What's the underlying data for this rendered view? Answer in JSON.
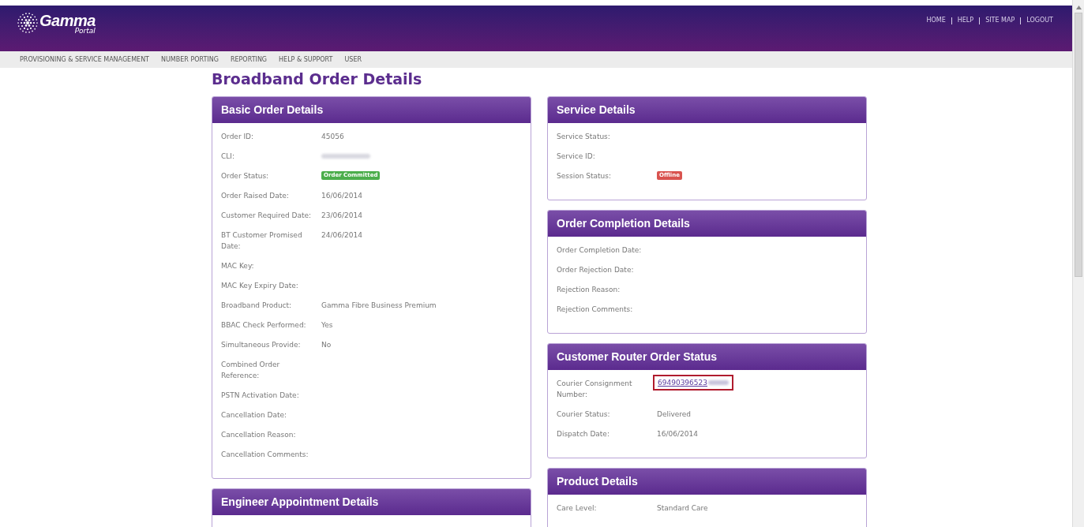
{
  "header": {
    "logo": {
      "name": "Gamma",
      "subtitle": "Portal"
    },
    "links": [
      "HOME",
      "HELP",
      "SITE MAP",
      "LOGOUT"
    ]
  },
  "nav": [
    "PROVISIONING & SERVICE MANAGEMENT",
    "NUMBER PORTING",
    "REPORTING",
    "HELP & SUPPORT",
    "USER"
  ],
  "page_title": "Broadband Order Details",
  "columns": [
    [
      {
        "title": "Basic Order Details",
        "rows": [
          {
            "label": "Order ID:",
            "kind": "text",
            "value": "45056"
          },
          {
            "label": "CLI:",
            "kind": "redacted"
          },
          {
            "label": "Order Status:",
            "kind": "badge",
            "value": "Order Committed",
            "color": "#4cae4c"
          },
          {
            "label": "Order Raised Date:",
            "kind": "text",
            "value": "16/06/2014"
          },
          {
            "label": "Customer Required Date:",
            "kind": "text",
            "value": "23/06/2014"
          },
          {
            "label": "BT Customer Promised Date:",
            "kind": "text",
            "value": "24/06/2014"
          },
          {
            "label": "MAC Key:",
            "kind": "empty"
          },
          {
            "label": "MAC Key Expiry Date:",
            "kind": "empty"
          },
          {
            "label": "Broadband Product:",
            "kind": "text",
            "value": "Gamma Fibre Business Premium"
          },
          {
            "label": "BBAC Check Performed:",
            "kind": "text",
            "value": "Yes"
          },
          {
            "label": "Simultaneous Provide:",
            "kind": "text",
            "value": "No"
          },
          {
            "label": "Combined Order Reference:",
            "kind": "empty"
          },
          {
            "label": "PSTN Activation Date:",
            "kind": "empty"
          },
          {
            "label": "Cancellation Date:",
            "kind": "empty"
          },
          {
            "label": "Cancellation Reason:",
            "kind": "empty"
          },
          {
            "label": "Cancellation Comments:",
            "kind": "empty"
          }
        ]
      },
      {
        "title": "Engineer Appointment Details"
      }
    ],
    [
      {
        "title": "Service Details",
        "rows": [
          {
            "label": "Service Status:",
            "kind": "empty"
          },
          {
            "label": "Service ID:",
            "kind": "empty"
          },
          {
            "label": "Session Status:",
            "kind": "badge",
            "value": "Offline",
            "color": "#d9534f"
          }
        ]
      },
      {
        "title": "Order Completion Details",
        "rows": [
          {
            "label": "Order Completion Date:",
            "kind": "empty"
          },
          {
            "label": "Order Rejection Date:",
            "kind": "empty"
          },
          {
            "label": "Rejection Reason:",
            "kind": "empty"
          },
          {
            "label": "Rejection Comments:",
            "kind": "empty"
          }
        ]
      },
      {
        "title": "Customer Router Order Status",
        "rows": [
          {
            "label": "Courier Consignment Number:",
            "kind": "link",
            "value": "69490396523",
            "highlighted": true
          },
          {
            "label": "Courier Status:",
            "kind": "text",
            "value": "Delivered"
          },
          {
            "label": "Dispatch Date:",
            "kind": "text",
            "value": "16/06/2014"
          }
        ]
      },
      {
        "title": "Product Details",
        "rows": [
          {
            "label": "Care Level:",
            "kind": "text",
            "value": "Standard Care"
          }
        ]
      }
    ]
  ]
}
